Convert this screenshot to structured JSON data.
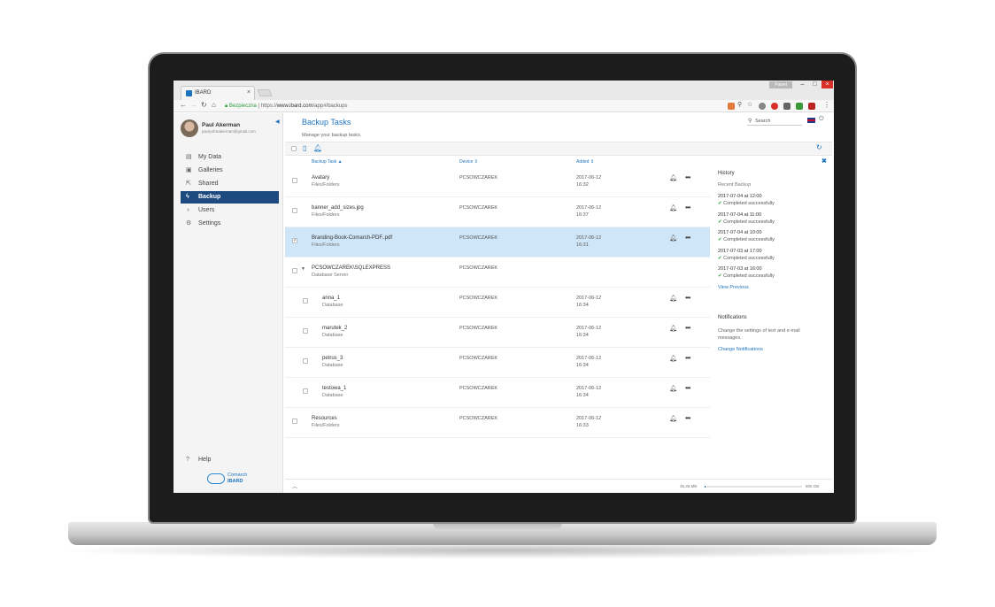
{
  "browser": {
    "tab_title": "IBARD",
    "tab_close": "×",
    "window_user": "Paweł",
    "win_min": "–",
    "win_max": "□",
    "win_close": "×",
    "secure_label": "Bezpieczna",
    "url_scheme": "https://",
    "url_host": "www.ibard.com",
    "url_path": "/app#/backups"
  },
  "sidebar": {
    "user_name": "Paul Akerman",
    "user_email": "paulyohnakerman@gmail.com",
    "items": [
      {
        "label": "My Data",
        "icon": "file-icon"
      },
      {
        "label": "Galleries",
        "icon": "image-icon"
      },
      {
        "label": "Shared",
        "icon": "share-icon"
      },
      {
        "label": "Backup",
        "icon": "bolt-icon",
        "active": true
      },
      {
        "label": "Users",
        "icon": "users-icon"
      },
      {
        "label": "Settings",
        "icon": "gear-icon"
      }
    ],
    "help_label": "Help",
    "logo_line1": "Comarch",
    "logo_line2": "IBARD"
  },
  "header": {
    "title": "Backup Tasks",
    "subtitle": "Manage your backup tasks.",
    "search_placeholder": "Search"
  },
  "table": {
    "columns": [
      "Backup Task ▲",
      "Device ⇕",
      "Added ⇕"
    ],
    "rows": [
      {
        "name": "Avatary",
        "type": "Files/Folders",
        "device": "PCSOWCZAREK",
        "date": "2017-06-12",
        "time": "16:32"
      },
      {
        "name": "banner_add_sizes.jpg",
        "type": "Files/Folders",
        "device": "PCSOWCZAREK",
        "date": "2017-06-12",
        "time": "16:37"
      },
      {
        "name": "Branding-Book-Comarch-PDF..pdf",
        "type": "Files/Folders",
        "device": "PCSOWCZAREK",
        "date": "2017-06-12",
        "time": "16:31",
        "selected": true
      },
      {
        "name": "PCSOWCZAREK\\SQLEXPRESS",
        "type": "Database Server",
        "device": "PCSOWCZAREK",
        "date": "",
        "time": ""
      },
      {
        "name": "anna_1",
        "type": "Database",
        "device": "PCSOWCZAREK",
        "date": "2017-06-12",
        "time": "16:34"
      },
      {
        "name": "marutek_2",
        "type": "Database",
        "device": "PCSOWCZAREK",
        "date": "2017-06-12",
        "time": "16:34"
      },
      {
        "name": "petrus_3",
        "type": "Database",
        "device": "PCSOWCZAREK",
        "date": "2017-06-12",
        "time": "16:34"
      },
      {
        "name": "testowa_1",
        "type": "Database",
        "device": "PCSOWCZAREK",
        "date": "2017-06-12",
        "time": "16:34"
      },
      {
        "name": "Resources",
        "type": "Files/Folders",
        "device": "PCSOWCZAREK",
        "date": "2017-06-12",
        "time": "16:33"
      }
    ],
    "more_glyph": "•••"
  },
  "history": {
    "title": "History",
    "subtitle": "Recent Backup",
    "entries": [
      {
        "date": "2017-07-04 at 12:00",
        "status": "Completed successfully"
      },
      {
        "date": "2017-07-04 at 11:00",
        "status": "Completed successfully"
      },
      {
        "date": "2017-07-04 at 10:00",
        "status": "Completed successfully"
      },
      {
        "date": "2017-07-03 at 17:00",
        "status": "Completed successfully"
      },
      {
        "date": "2017-07-03 at 16:00",
        "status": "Completed successfully"
      }
    ],
    "view_previous": "View Previous",
    "notifications_title": "Notifications",
    "notifications_text": "Change the settings of text and e-mail messages.",
    "change_notifications": "Change Notifications"
  },
  "footer": {
    "used": "35,35 MB",
    "total": "500 GB",
    "usage_fraction": 0.0001
  },
  "colors": {
    "accent": "#1e73be",
    "sidebar_active": "#1d4a7f",
    "selected_row": "#cfe6f8",
    "success": "#2e9e3b"
  }
}
